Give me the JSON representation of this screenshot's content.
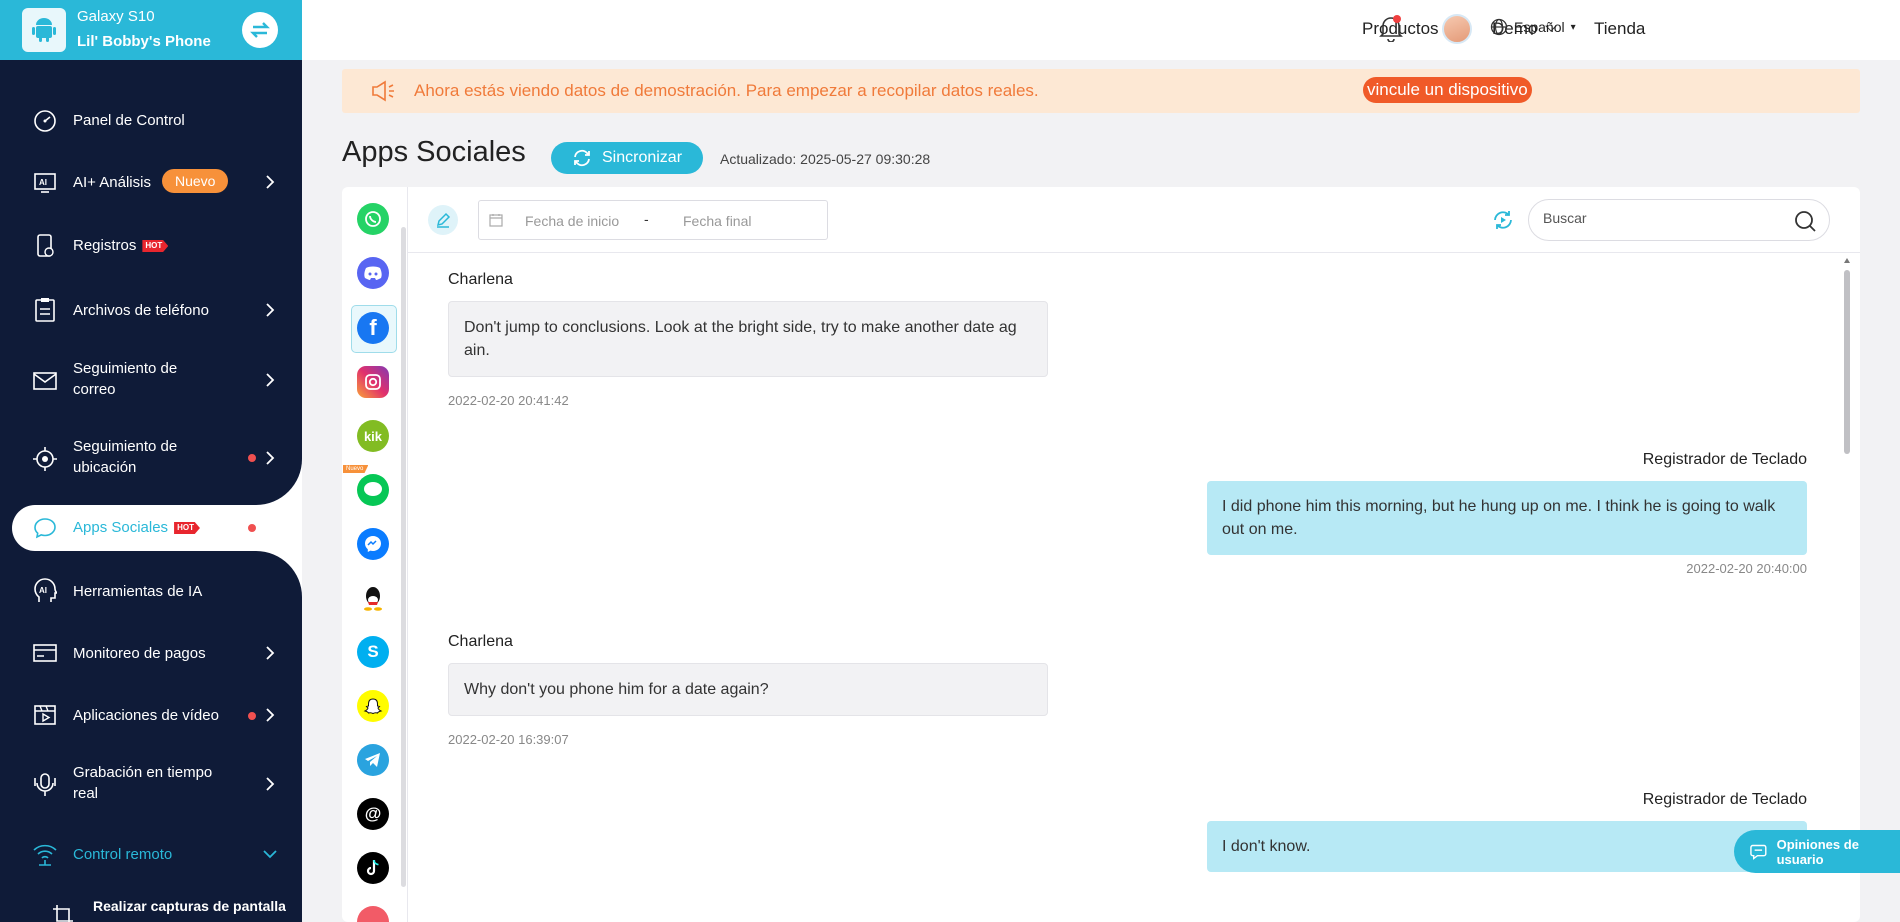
{
  "device": {
    "model": "Galaxy S10",
    "name": "Lil' Bobby's Phone"
  },
  "sidebar": {
    "items": [
      {
        "label": "Panel de Control",
        "icon": "gauge-icon"
      },
      {
        "label": "AI+ Análisis",
        "badge": "Nuevo",
        "icon": "ai-screen-icon"
      },
      {
        "label": "Registros",
        "tag": "HOT",
        "icon": "phone-log-icon"
      },
      {
        "label": "Archivos de teléfono",
        "icon": "clipboard-icon"
      },
      {
        "label": "Seguimiento de correo",
        "icon": "mail-icon"
      },
      {
        "label": "Seguimiento de ubicación",
        "icon": "location-icon"
      },
      {
        "label": "Apps Sociales",
        "tag": "HOT",
        "icon": "chat-bubble-icon"
      },
      {
        "label": "Herramientas de IA",
        "icon": "ai-head-icon"
      },
      {
        "label": "Monitoreo de pagos",
        "icon": "card-icon"
      },
      {
        "label": "Aplicaciones de vídeo",
        "icon": "video-icon"
      },
      {
        "label": "Grabación en tiempo real",
        "icon": "microphone-icon"
      },
      {
        "label": "Control remoto",
        "icon": "wifi-icon"
      },
      {
        "label": "Realizar capturas de pantalla",
        "icon": "crop-icon"
      }
    ]
  },
  "header": {
    "nav": [
      "Productos",
      "Demo",
      "Tienda"
    ],
    "language": "Español"
  },
  "banner": {
    "text": "Ahora estás viendo datos de demostración. Para empezar a recopilar datos reales.",
    "link": "vincule un dispositivo"
  },
  "page": {
    "title": "Apps Sociales",
    "sync_label": "Sincronizar",
    "updated": "Actualizado: 2025-05-27 09:30:28"
  },
  "apps": [
    {
      "name": "whatsapp-icon",
      "color": "#25d366"
    },
    {
      "name": "discord-icon",
      "color": "#5865f2"
    },
    {
      "name": "facebook-icon",
      "color": "#1877f2"
    },
    {
      "name": "instagram-icon",
      "color": "#e1306c"
    },
    {
      "name": "kik-icon",
      "color": "#82bc23"
    },
    {
      "name": "line-icon",
      "color": "#06c755"
    },
    {
      "name": "messenger-icon",
      "color": "#0a7cff"
    },
    {
      "name": "qq-icon",
      "color": "#111111"
    },
    {
      "name": "skype-icon",
      "color": "#00aff0"
    },
    {
      "name": "snapchat-icon",
      "color": "#fffc00"
    },
    {
      "name": "telegram-icon",
      "color": "#2aa3df"
    },
    {
      "name": "threads-icon",
      "color": "#000000"
    },
    {
      "name": "tiktok-icon",
      "color": "#000000"
    }
  ],
  "apps_new_tag": "Nuevo",
  "filters": {
    "start_placeholder": "Fecha de inicio",
    "separator": "-",
    "end_placeholder": "Fecha final",
    "search_placeholder": "Buscar"
  },
  "messages": [
    {
      "sender": "Charlena",
      "text": "Don't jump to conclusions. Look at the bright side, try to make another date ag ain.",
      "time": "2022-02-20 20:41:42",
      "direction": "in"
    },
    {
      "sender": "Registrador de Teclado",
      "text": "I did phone him this morning, but he hung up on me. I think he is going to walk out on me.",
      "time": "2022-02-20 20:40:00",
      "direction": "out"
    },
    {
      "sender": "Charlena",
      "text": "Why don't you phone him for a date again?",
      "time": "2022-02-20 16:39:07",
      "direction": "in"
    },
    {
      "sender": "Registrador de Teclado",
      "text": "I don't know.",
      "time": "",
      "direction": "out"
    }
  ],
  "feedback_label": "Opiniones de usuario",
  "colors": {
    "accent": "#2ab8d8",
    "sidebar_bg": "#0f1b38",
    "banner_bg": "#fde8d4",
    "banner_text": "#f07a3a",
    "badge_orange": "#f7913a",
    "hot_red": "#e8262e"
  }
}
